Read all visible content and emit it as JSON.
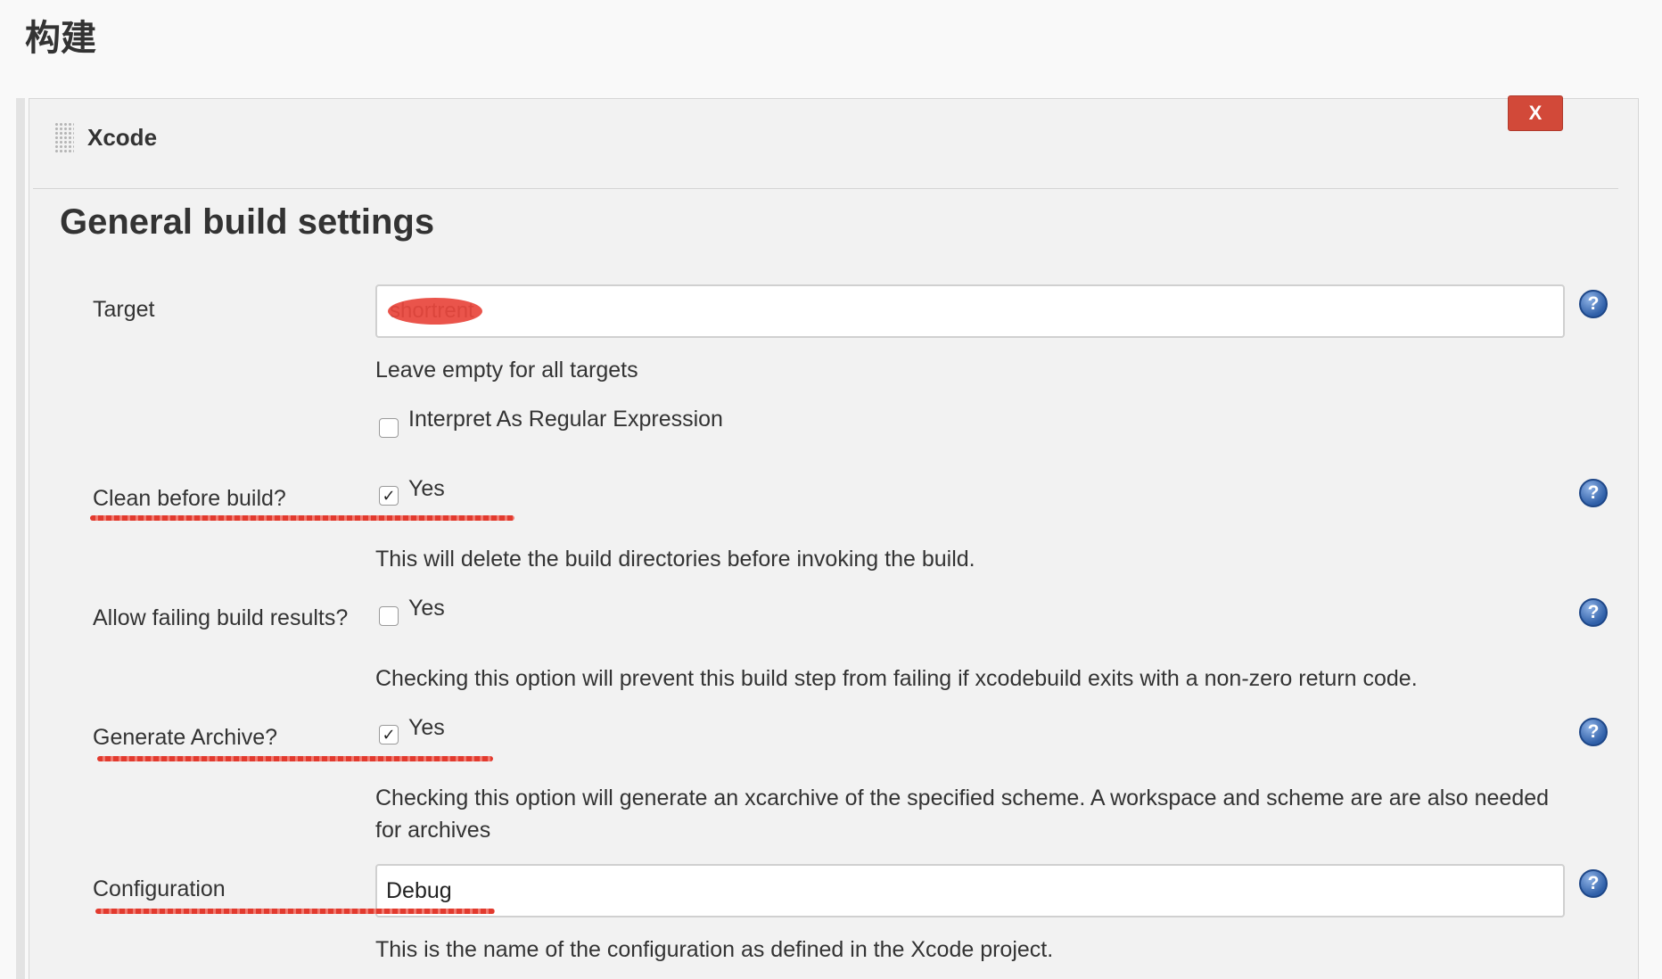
{
  "page": {
    "section_title": "构建"
  },
  "step": {
    "name": "Xcode",
    "delete_label": "X"
  },
  "heading": "General build settings",
  "target": {
    "label": "Target",
    "value": "shortrent",
    "help": "Leave empty for all targets",
    "regex_label": "Interpret As Regular Expression",
    "regex_checked": false
  },
  "clean": {
    "label": "Clean before build?",
    "option": "Yes",
    "checked": true,
    "help": "This will delete the build directories before invoking the build."
  },
  "allow_failing": {
    "label": "Allow failing build results?",
    "option": "Yes",
    "checked": false,
    "help": "Checking this option will prevent this build step from failing if xcodebuild exits with a non-zero return code."
  },
  "archive": {
    "label": "Generate Archive?",
    "option": "Yes",
    "checked": true,
    "help": "Checking this option will generate an xcarchive of the specified scheme. A workspace and scheme are are also needed for archives"
  },
  "configuration": {
    "label": "Configuration",
    "value": "Debug",
    "help": "This is the name of the configuration as defined in the Xcode project."
  },
  "icons": {
    "help": "question-mark-icon",
    "handle": "drag-handle-icon",
    "check": "✓",
    "help_glyph": "?"
  },
  "colors": {
    "delete": "#d24939",
    "help": "#2f5fa8",
    "annotation": "#e23a2e"
  }
}
